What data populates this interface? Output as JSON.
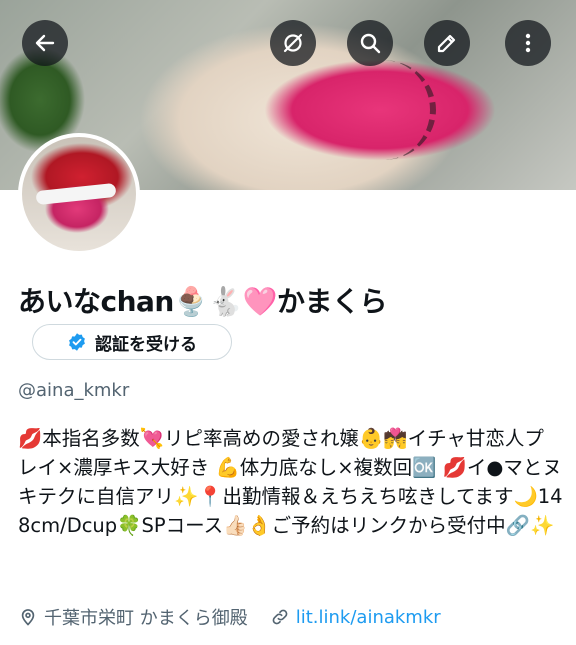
{
  "header": {
    "buttons": [
      {
        "name": "back",
        "icon": "back-arrow-icon"
      },
      {
        "name": "grok",
        "icon": "grok-icon"
      },
      {
        "name": "search",
        "icon": "search-icon"
      },
      {
        "name": "edit",
        "icon": "edit-pencil-icon"
      },
      {
        "name": "more",
        "icon": "more-vertical-icon"
      }
    ]
  },
  "profile": {
    "display_name": "あいなchan🍨🐇🩷かまくら",
    "verify_button_label": "認証を受ける",
    "handle": "@aina_kmkr",
    "bio": "💋本指名多数💘リピ率高めの愛され嬢👶💏イチャ甘恋人プレイ×濃厚キス大好き 💪体力底なし×複数回🆗 💋イ●マとヌキテクに自信アリ✨📍出勤情報＆えちえち呟きしてます🌙148cm/Dcup🍀SPコース👍🏻👌ご予約はリンクから受付中🔗✨",
    "location": "千葉市栄町 かまくら御殿",
    "link": "lit.link/ainakmkr"
  },
  "colors": {
    "accent": "#1d9bf0",
    "secondary_text": "#536471",
    "button_bg": "#0f1419"
  }
}
